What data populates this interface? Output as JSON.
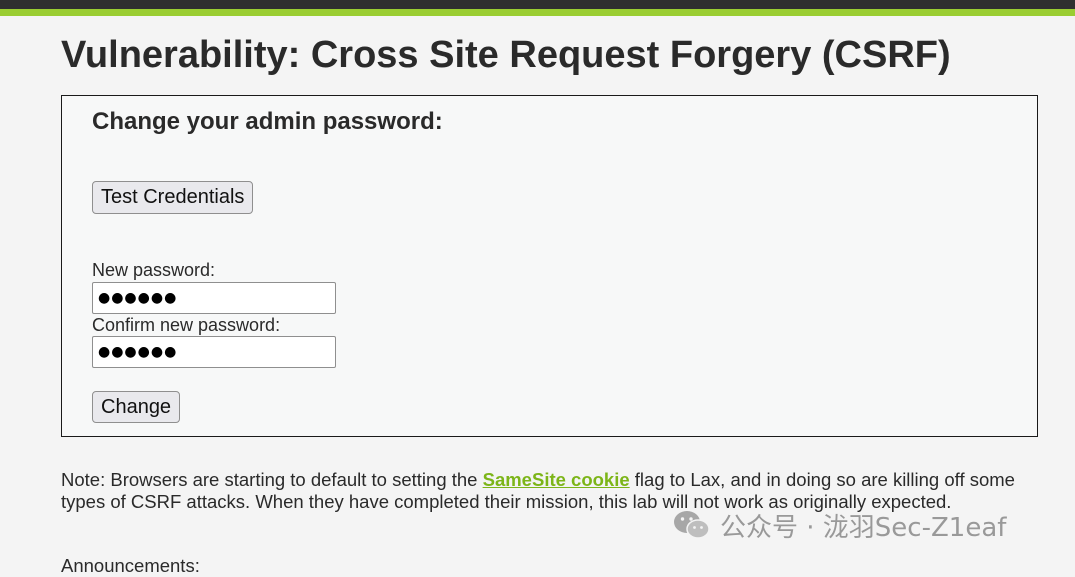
{
  "page": {
    "title": "Vulnerability: Cross Site Request Forgery (CSRF)"
  },
  "form": {
    "heading": "Change your admin password:",
    "test_button_label": "Test Credentials",
    "new_password_label": "New password:",
    "new_password_value": "●●●●●●",
    "confirm_password_label": "Confirm new password:",
    "confirm_password_value": "●●●●●●",
    "change_button_label": "Change"
  },
  "note": {
    "prefix": "Note: Browsers are starting to default to setting the ",
    "link_text": "SameSite cookie",
    "suffix": " flag to Lax, and in doing so are killing off some types of CSRF attacks. When they have completed their mission, this lab will not work as originally expected."
  },
  "announcements_label": "Announcements:",
  "watermark": {
    "text": "公众号 · 泷羽Sec-Z1eaf",
    "icon": "wechat-icon"
  },
  "colors": {
    "accent": "#9acd32",
    "topbar": "#2f2f2f",
    "link": "#7cb518",
    "background": "#f4f4f4"
  }
}
